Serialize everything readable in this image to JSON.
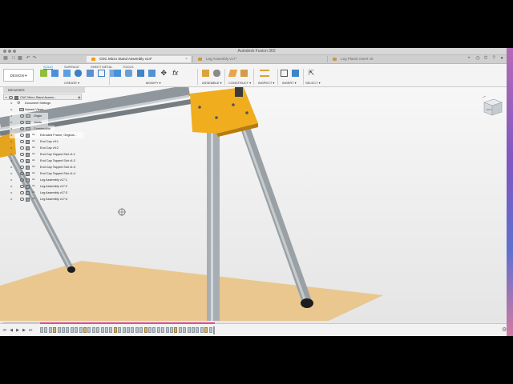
{
  "window": {
    "title": "Autodesk Fusion 360"
  },
  "tabs": [
    {
      "label": "CNC Micro Stand Assembly v14*",
      "active": true
    },
    {
      "label": "Leg Assembly v17*",
      "active": false
    },
    {
      "label": "Leg Plastic Insert v6",
      "active": false
    }
  ],
  "toolbar": {
    "workspace": "DESIGN ▾",
    "tool_tabs": [
      "SOLID",
      "SURFACE",
      "SHEET METAL",
      "TOOLS"
    ],
    "groups": [
      {
        "label": "CREATE ▾"
      },
      {
        "label": "MODIFY ▾"
      },
      {
        "label": "ASSEMBLE ▾"
      },
      {
        "label": "CONSTRUCT ▾"
      },
      {
        "label": "INSPECT ▾"
      },
      {
        "label": "INSERT ▾"
      },
      {
        "label": "SELECT ▾"
      }
    ]
  },
  "browser": {
    "header": "BROWSER",
    "root": "CNC Micro Stand Assem...",
    "items": [
      {
        "label": "Document Settings",
        "kind": "gear"
      },
      {
        "label": "Named Views",
        "kind": "folder"
      },
      {
        "label": "Origin",
        "kind": "folder"
      },
      {
        "label": "Joints",
        "kind": "folder"
      },
      {
        "label": "Construction",
        "kind": "folder"
      },
      {
        "label": "Extruded Frame, Original...",
        "kind": "comp"
      },
      {
        "label": "End Cap v9:1",
        "kind": "comp"
      },
      {
        "label": "End Cap v9:2",
        "kind": "comp"
      },
      {
        "label": "End Cap Tapped Slot v1:1",
        "kind": "comp"
      },
      {
        "label": "End Cap Tapped Slot v1:2",
        "kind": "comp"
      },
      {
        "label": "End Cap Tapped Slot v1:3",
        "kind": "comp"
      },
      {
        "label": "End Cap Tapped Slot v1:4",
        "kind": "comp"
      },
      {
        "label": "Leg Assembly v17:1",
        "kind": "comp"
      },
      {
        "label": "Leg Assembly v17:2",
        "kind": "comp"
      },
      {
        "label": "Leg Assembly v17:3",
        "kind": "comp"
      },
      {
        "label": "Leg Assembly v17:4",
        "kind": "comp"
      }
    ]
  },
  "comments": {
    "label": "COMMENTS",
    "add": "+"
  },
  "viewcube": {
    "face": "LEFT"
  },
  "colors": {
    "accent": "#0696d7",
    "gold": "#f0ad1e",
    "floor": "#e6c48e",
    "timeline_progress": "#e64a8c"
  }
}
